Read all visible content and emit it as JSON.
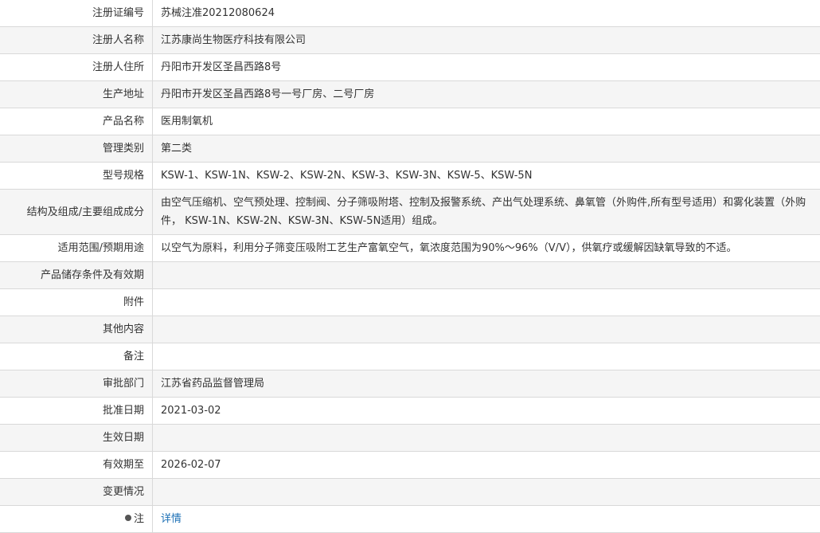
{
  "rows": [
    {
      "label": "注册证编号",
      "value": "苏械注准20212080624"
    },
    {
      "label": "注册人名称",
      "value": "江苏康尚生物医疗科技有限公司"
    },
    {
      "label": "注册人住所",
      "value": "丹阳市开发区圣昌西路8号"
    },
    {
      "label": "生产地址",
      "value": "丹阳市开发区圣昌西路8号一号厂房、二号厂房"
    },
    {
      "label": "产品名称",
      "value": "医用制氧机"
    },
    {
      "label": "管理类别",
      "value": "第二类"
    },
    {
      "label": "型号规格",
      "value": "KSW-1、KSW-1N、KSW-2、KSW-2N、KSW-3、KSW-3N、KSW-5、KSW-5N"
    },
    {
      "label": "结构及组成/主要组成成分",
      "value": "由空气压缩机、空气预处理、控制阀、分子筛吸附塔、控制及报警系统、产出气处理系统、鼻氧管（外购件,所有型号适用）和雾化装置（外购件， KSW-1N、KSW-2N、KSW-3N、KSW-5N适用）组成。"
    },
    {
      "label": "适用范围/预期用途",
      "value": "以空气为原料，利用分子筛变压吸附工艺生产富氧空气，氧浓度范围为90%～96%（V/V），供氧疗或缓解因缺氧导致的不适。"
    },
    {
      "label": "产品储存条件及有效期",
      "value": ""
    },
    {
      "label": "附件",
      "value": ""
    },
    {
      "label": "其他内容",
      "value": ""
    },
    {
      "label": "备注",
      "value": ""
    },
    {
      "label": "审批部门",
      "value": "江苏省药品监督管理局"
    },
    {
      "label": "批准日期",
      "value": "2021-03-02"
    },
    {
      "label": "生效日期",
      "value": ""
    },
    {
      "label": "有效期至",
      "value": "2026-02-07"
    },
    {
      "label": "变更情况",
      "value": ""
    }
  ],
  "note": {
    "label": "注",
    "link": "详情"
  }
}
